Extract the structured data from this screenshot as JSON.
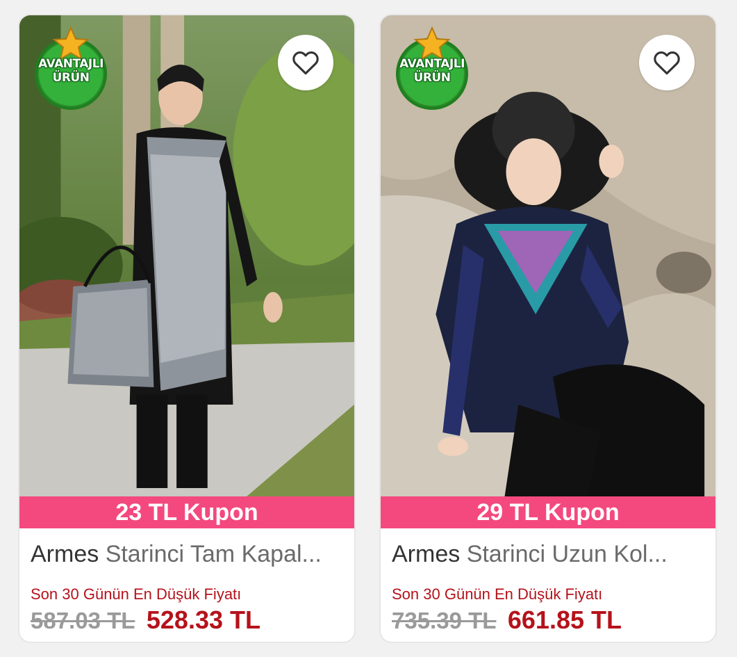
{
  "products": [
    {
      "badge_line1": "AVANTAJLI",
      "badge_line2": "ÜRÜN",
      "coupon": "23 TL Kupon",
      "brand": "Armes",
      "name": "Starinci Tam Kapal...",
      "lowest_price_label": "Son 30 Günün En Düşük Fiyatı",
      "old_price": "587.03 TL",
      "price": "528.33 TL"
    },
    {
      "badge_line1": "AVANTAJLI",
      "badge_line2": "ÜRÜN",
      "coupon": "29 TL Kupon",
      "brand": "Armes",
      "name": "Starinci Uzun Kol...",
      "lowest_price_label": "Son 30 Günün En Düşük Fiyatı",
      "old_price": "735.39 TL",
      "price": "661.85 TL"
    }
  ],
  "colors": {
    "coupon_bg": "#f4497e",
    "price_red": "#b5121b",
    "badge_green": "#2e9e2e",
    "star_gold": "#f5b321"
  },
  "icons": {
    "favorite": "heart-outline-icon",
    "badge_star": "star-icon"
  }
}
